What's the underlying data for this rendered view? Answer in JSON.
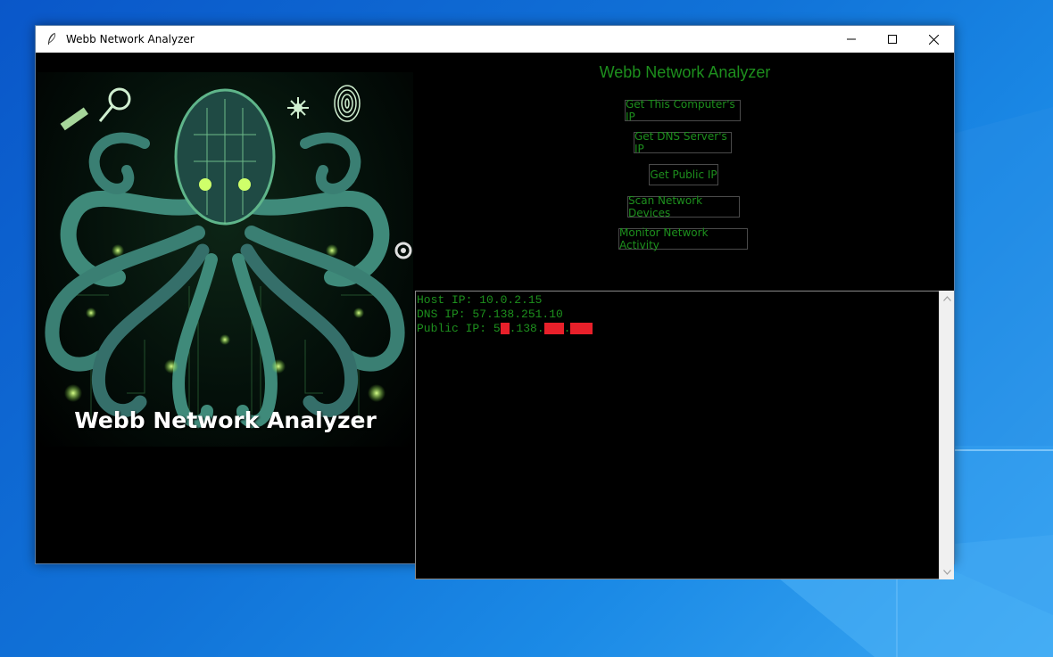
{
  "window": {
    "title": "Webb Network Analyzer"
  },
  "app": {
    "heading": "Webb Network Analyzer",
    "banner_text": "Webb Network Analyzer",
    "accent_color": "#1d8f1d",
    "buttons": [
      "Get This Computer's IP",
      "Get DNS Server's IP",
      "Get Public IP",
      "Scan Network Devices",
      "Monitor Network Activity"
    ]
  },
  "output": {
    "host_ip": "Host IP: 10.0.2.15",
    "dns_ip": "DNS IP: 57.138.251.10",
    "public_ip_prefix": "Public IP: 5",
    "public_ip_mid1": ".138.",
    "public_ip_mid2": "."
  }
}
